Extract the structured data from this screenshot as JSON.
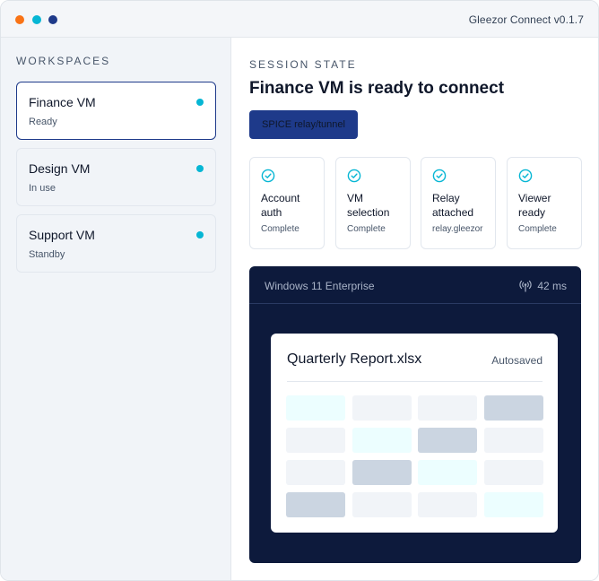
{
  "app": {
    "title": "Gleezor Connect v0.1.7",
    "window_dots": [
      {
        "name": "dot-orange",
        "color": "#f97316"
      },
      {
        "name": "dot-cyan",
        "color": "#06b6d4"
      },
      {
        "name": "dot-navy",
        "color": "#1e3a8a"
      }
    ]
  },
  "sidebar": {
    "heading": "WORKSPACES",
    "items": [
      {
        "name": "Finance VM",
        "status": "Ready",
        "active": true,
        "dot_color": "#06b6d4"
      },
      {
        "name": "Design VM",
        "status": "In use",
        "active": false,
        "dot_color": "#06b6d4"
      },
      {
        "name": "Support VM",
        "status": "Standby",
        "active": false,
        "dot_color": "#06b6d4"
      }
    ]
  },
  "main": {
    "eyebrow": "SESSION STATE",
    "title": "Finance VM is ready to connect",
    "mode_button": {
      "label": "SPICE relay/tunnel",
      "color": "#1e3a8a"
    },
    "steps": [
      {
        "label": "Account auth",
        "status": "Complete",
        "icon": "check-circle-icon"
      },
      {
        "label": "VM selection",
        "status": "Complete",
        "icon": "check-circle-icon"
      },
      {
        "label": "Relay attached",
        "status": "relay.gleezor",
        "icon": "check-circle-icon"
      },
      {
        "label": "Viewer ready",
        "status": "Complete",
        "icon": "check-circle-icon"
      }
    ],
    "viewer": {
      "os_name": "Windows 11 Enterprise",
      "latency": "42 ms",
      "latency_icon": "signal-icon",
      "document": {
        "title": "Quarterly Report.xlsx",
        "status": "Autosaved",
        "grid": [
          [
            "cyan",
            "light",
            "light",
            "slate"
          ],
          [
            "light",
            "cyan",
            "slate",
            "light"
          ],
          [
            "light",
            "slate",
            "cyan",
            "light"
          ],
          [
            "slate",
            "light",
            "light",
            "cyan"
          ]
        ]
      }
    }
  },
  "colors": {
    "accent": "#1e3a8a",
    "check": "#06b6d4",
    "viewer_bg": "#0d1a3c",
    "cell_light": "#f1f4f8",
    "cell_cyan": "#ecfeff",
    "cell_slate": "#cbd5e1"
  }
}
